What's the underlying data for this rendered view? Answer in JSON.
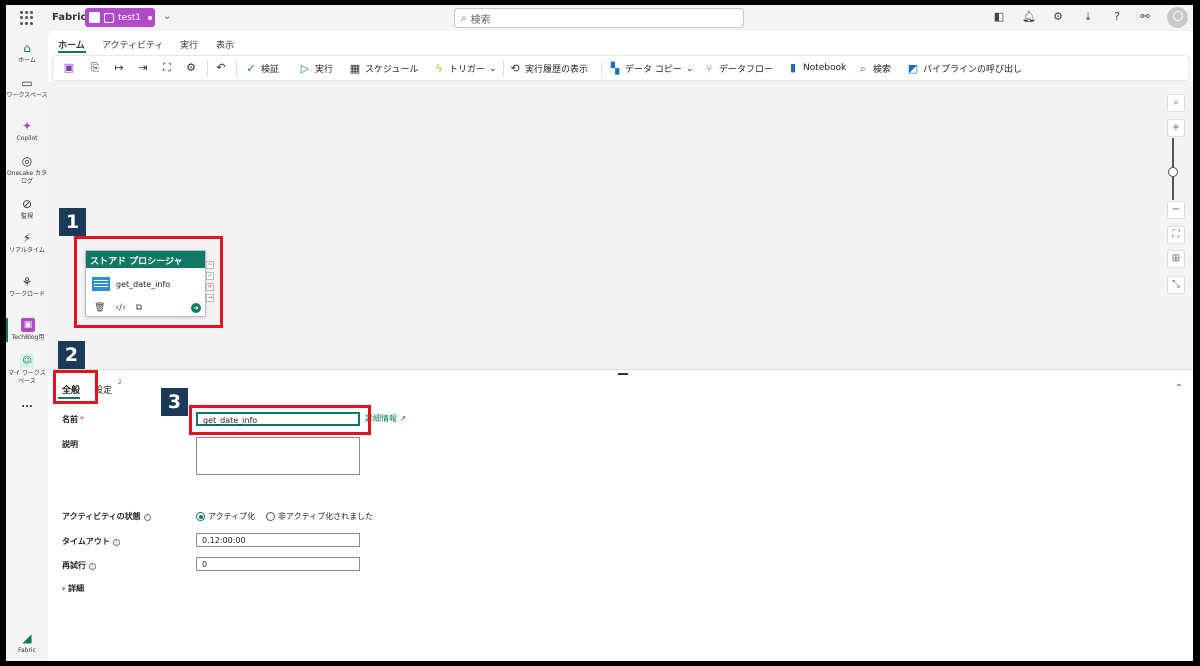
{
  "topbar": {
    "brand": "Fabric",
    "workspace": "test1",
    "search_placeholder": "検索"
  },
  "rail": {
    "items": [
      {
        "label": "ホーム",
        "icon": "home-icon"
      },
      {
        "label": "ワークスペース",
        "icon": "workspace-icon"
      },
      {
        "label": "Copilot",
        "icon": "copilot-icon"
      },
      {
        "label": "OneLake カタログ",
        "icon": "onelake-icon"
      },
      {
        "label": "監視",
        "icon": "monitor-icon"
      },
      {
        "label": "リアルタイム",
        "icon": "realtime-icon"
      },
      {
        "label": "ワークロード",
        "icon": "workload-icon"
      },
      {
        "label": "TechBlog用",
        "icon": "techblog-icon"
      },
      {
        "label": "マイ ワークスペース",
        "icon": "my-workspace-icon"
      }
    ],
    "more": "...",
    "bottom": "Fabric"
  },
  "main_tabs": [
    "ホーム",
    "アクティビティ",
    "実行",
    "表示"
  ],
  "ribbon": {
    "validate": "検証",
    "run": "実行",
    "schedule": "スケジュール",
    "trigger": "トリガー",
    "history": "実行履歴の表示",
    "copy_data": "データ コピー",
    "dataflow": "データフロー",
    "notebook": "Notebook",
    "search": "検索",
    "invoke_pipeline": "パイプラインの呼び出し"
  },
  "activity": {
    "title": "ストアド プロシージャ",
    "name": "get_date_info"
  },
  "badges": [
    "1",
    "2",
    "3"
  ],
  "props": {
    "tabs": [
      "全般",
      "設定"
    ],
    "settings_badge": "2",
    "name_label": "名前",
    "required_mark": "*",
    "name_value": "get_date_info",
    "more_info": "詳細情報",
    "description_label": "説明",
    "state_label": "アクティビティの状態",
    "state_active": "アクティブ化",
    "state_inactive": "非アクティブ化されました",
    "timeout_label": "タイムアウト",
    "timeout_value": "0.12:00:00",
    "retry_label": "再試行",
    "retry_value": "0",
    "advanced_label": "詳細"
  },
  "colors": {
    "accent": "#117865",
    "workspace_pill": "#b249c8",
    "highlight": "#e0141e",
    "badge": "#1b3a57"
  }
}
